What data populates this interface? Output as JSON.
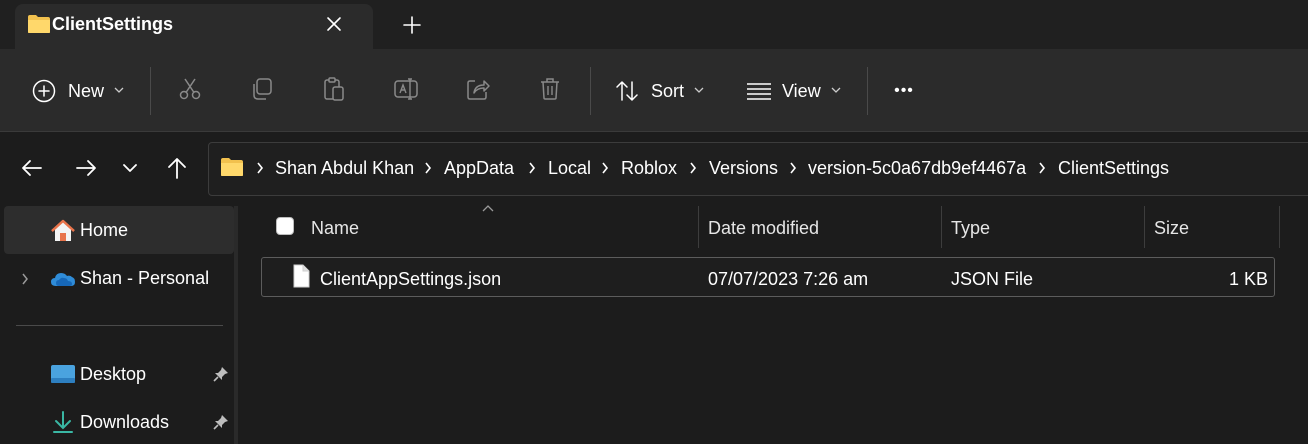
{
  "window": {
    "tab_title": "ClientSettings"
  },
  "toolbar": {
    "new_label": "New",
    "sort_label": "Sort",
    "view_label": "View",
    "more_label": "•••"
  },
  "breadcrumb": [
    "Shan Abdul Khan",
    "AppData",
    "Local",
    "Roblox",
    "Versions",
    "version-5c0a67db9ef4467a",
    "ClientSettings"
  ],
  "nav": {
    "home": "Home",
    "onedrive": "Shan - Personal",
    "desktop": "Desktop",
    "downloads": "Downloads"
  },
  "columns": {
    "name": "Name",
    "date": "Date modified",
    "type": "Type",
    "size": "Size"
  },
  "files": [
    {
      "name": "ClientAppSettings.json",
      "date": "07/07/2023 7:26 am",
      "type": "JSON File",
      "size": "1 KB"
    }
  ],
  "colors": {
    "folder": "#f2c14e",
    "onedrive": "#2f8cd8",
    "desktop": "#4aa3df",
    "download": "#3ab7a4",
    "home": "#e8734a"
  }
}
